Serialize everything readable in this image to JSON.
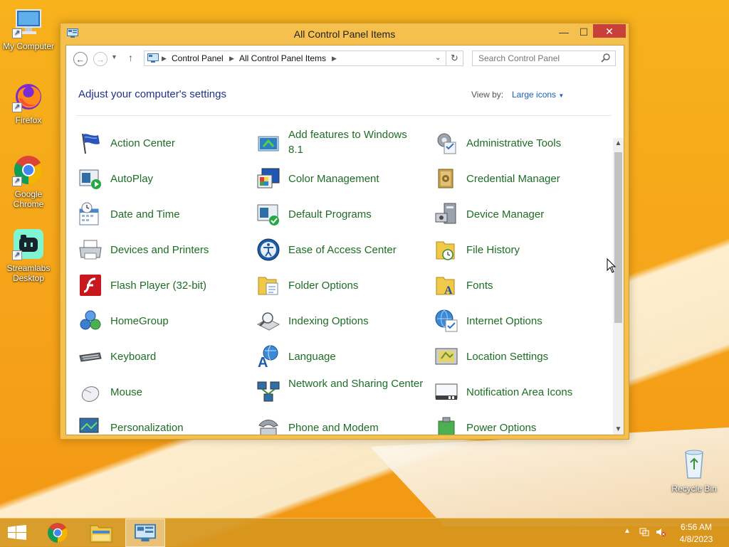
{
  "desktop": {
    "icons": [
      {
        "label": "My Computer"
      },
      {
        "label": "Firefox"
      },
      {
        "label": "Google Chrome"
      },
      {
        "label": "Streamlabs Desktop"
      },
      {
        "label": "Recycle Bin"
      }
    ]
  },
  "window": {
    "title": "All Control Panel Items",
    "controls": {
      "minimize": "—",
      "maximize": "☐",
      "close": "✕"
    },
    "breadcrumb": [
      "Control Panel",
      "All Control Panel Items"
    ],
    "search_placeholder": "Search Control Panel",
    "heading": "Adjust your computer's settings",
    "view_by_label": "View by:",
    "view_by_value": "Large icons"
  },
  "items": [
    {
      "label": "Action Center",
      "icon": "flag-icon"
    },
    {
      "label": "Add features to Windows 8.1",
      "icon": "add-features-icon"
    },
    {
      "label": "Administrative Tools",
      "icon": "admin-tools-icon"
    },
    {
      "label": "AutoPlay",
      "icon": "autoplay-icon"
    },
    {
      "label": "Color Management",
      "icon": "color-management-icon"
    },
    {
      "label": "Credential Manager",
      "icon": "credential-vault-icon"
    },
    {
      "label": "Date and Time",
      "icon": "calendar-clock-icon"
    },
    {
      "label": "Default Programs",
      "icon": "default-programs-icon"
    },
    {
      "label": "Device Manager",
      "icon": "device-manager-icon"
    },
    {
      "label": "Devices and Printers",
      "icon": "printer-icon"
    },
    {
      "label": "Ease of Access Center",
      "icon": "ease-of-access-icon"
    },
    {
      "label": "File History",
      "icon": "file-history-icon"
    },
    {
      "label": "Flash Player (32-bit)",
      "icon": "flash-icon"
    },
    {
      "label": "Folder Options",
      "icon": "folder-options-icon"
    },
    {
      "label": "Fonts",
      "icon": "fonts-folder-icon"
    },
    {
      "label": "HomeGroup",
      "icon": "homegroup-icon"
    },
    {
      "label": "Indexing Options",
      "icon": "indexing-icon"
    },
    {
      "label": "Internet Options",
      "icon": "internet-options-icon"
    },
    {
      "label": "Keyboard",
      "icon": "keyboard-icon"
    },
    {
      "label": "Language",
      "icon": "language-icon"
    },
    {
      "label": "Location Settings",
      "icon": "location-icon"
    },
    {
      "label": "Mouse",
      "icon": "mouse-icon"
    },
    {
      "label": "Network and Sharing Center",
      "icon": "network-icon"
    },
    {
      "label": "Notification Area Icons",
      "icon": "notification-area-icon"
    },
    {
      "label": "Personalization",
      "icon": "personalization-icon"
    },
    {
      "label": "Phone and Modem",
      "icon": "phone-modem-icon"
    },
    {
      "label": "Power Options",
      "icon": "power-options-icon"
    }
  ],
  "taskbar": {
    "time": "6:56 AM",
    "date": "4/8/2023"
  }
}
